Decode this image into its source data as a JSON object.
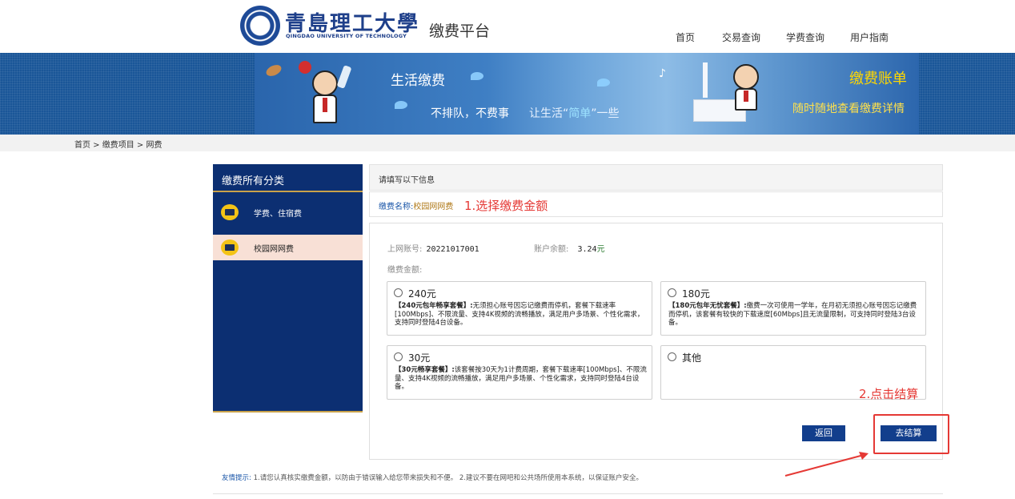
{
  "header": {
    "logo_cn": "青島理工大學",
    "logo_en": "QINGDAO UNIVERSITY OF TECHNOLOGY",
    "platform_title": "缴费平台",
    "nav": [
      "首页",
      "交易查询",
      "学费查询",
      "用户指南"
    ]
  },
  "banner": {
    "left_title": "生活缴费",
    "slogan_1": "不排队，不费事",
    "slogan_2_pre": "让生活“",
    "slogan_2_hl": "简单",
    "slogan_2_post": "”一些",
    "right_title": "缴费账单",
    "right_sub": "随时随地查看缴费详情"
  },
  "breadcrumb": "首页 > 缴费项目 > 网费",
  "sidebar": {
    "title": "缴费所有分类",
    "items": [
      {
        "label": "学费、住宿费",
        "active": false
      },
      {
        "label": "校园网网费",
        "active": true
      }
    ]
  },
  "form": {
    "header": "请填写以下信息",
    "fee_name_label": "缴费名称:",
    "fee_name_value": "校园网网费",
    "account_label": "上网账号:",
    "account_value": "20221017001",
    "balance_label": "账户余额:",
    "balance_value": "3.24",
    "balance_unit": "元",
    "amount_label": "缴费金额:",
    "options": [
      {
        "label": "240元",
        "title": "【240元包年畅享套餐】:",
        "desc": "无须担心账号因忘记缴费而停机，套餐下载速率[100Mbps]、不限流量、支持4K视频的流畅播放，满足用户多场景、个性化需求，支持同时登陆4台设备。"
      },
      {
        "label": "180元",
        "title": "【180元包年无忧套餐】:",
        "desc": "缴费一次可使用一学年，在月初无须担心账号因忘记缴费而停机，该套餐有较快的下载速度[60Mbps]且无流量限制，可支持同时登陆3台设备。"
      },
      {
        "label": "30元",
        "title": "【30元畅享套餐】:",
        "desc": "该套餐按30天为1计费周期，套餐下载速率[100Mbps]、不限流量、支持4K视频的流畅播放，满足用户多场景、个性化需求，支持同时登陆4台设备。"
      },
      {
        "label": "其他",
        "title": "",
        "desc": ""
      }
    ],
    "back_button": "返回",
    "checkout_button": "去结算"
  },
  "annotations": {
    "step1": "1.选择缴费金额",
    "step2": "2.点击结算"
  },
  "tip": {
    "key": "友情提示:",
    "text": "1.请您认真核实缴费金额，以防由于错误输入给您带来损失和不便。   2.建议不要在网吧和公共场所使用本系统，以保证账户安全。"
  },
  "colors": {
    "navy": "#0c2f72",
    "button": "#123e8c",
    "annotation_red": "#e53935",
    "accent_gold": "#c9a24a"
  }
}
